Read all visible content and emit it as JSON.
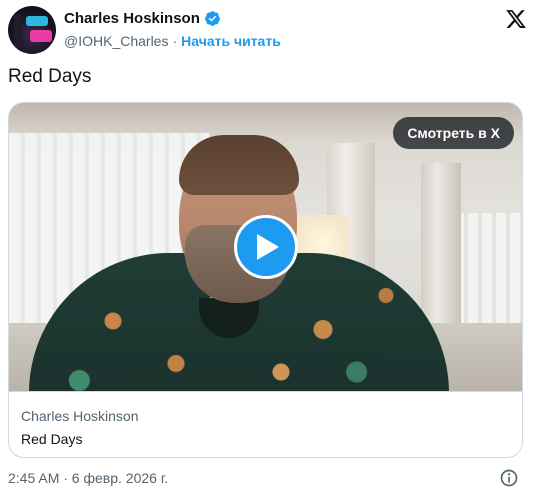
{
  "header": {
    "display_name": "Charles Hoskinson",
    "handle": "@IOHK_Charles",
    "separator": "·",
    "follow_label": "Начать читать",
    "verified_icon": "verified-badge-icon",
    "logo_icon": "x-logo-icon"
  },
  "tweet": {
    "text": "Red Days"
  },
  "card": {
    "watch_label": "Смотреть в X",
    "play_icon": "play-icon",
    "author": "Charles Hoskinson",
    "title": "Red Days"
  },
  "footer": {
    "timestamp": "2:45 AM · 6 февр. 2026 г.",
    "info_icon": "info-icon"
  },
  "colors": {
    "accent": "#1d9bf0",
    "text_primary": "#0f1419",
    "text_secondary": "#536471",
    "border": "#cfd9de"
  }
}
